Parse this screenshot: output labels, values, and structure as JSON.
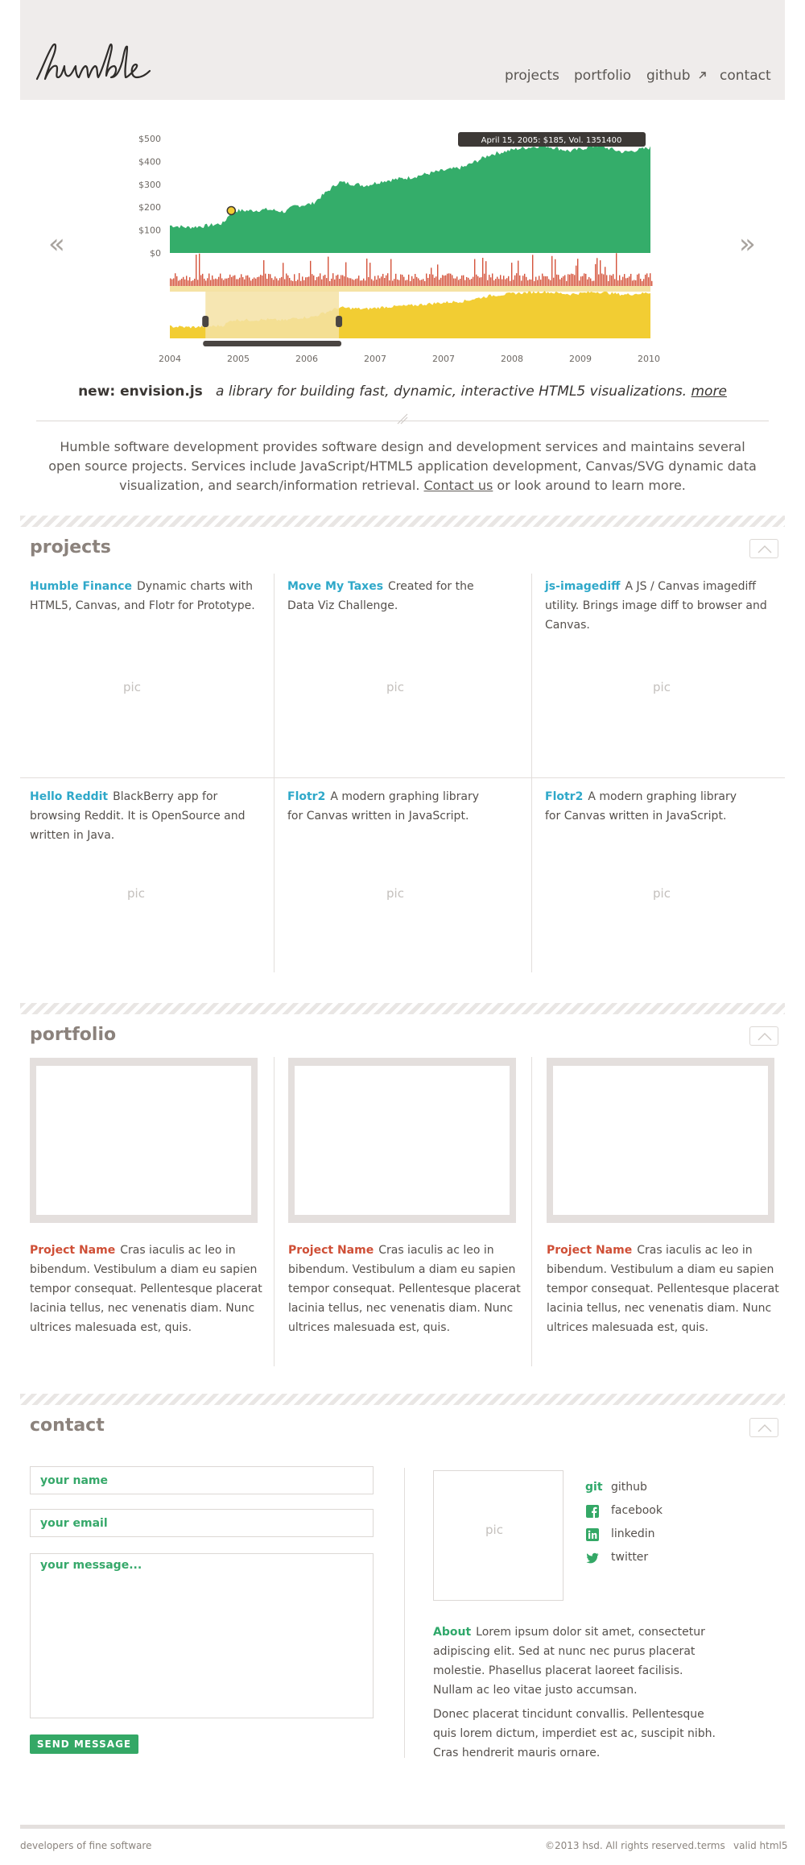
{
  "header": {
    "logo_text": "humble",
    "nav": [
      {
        "label": "projects"
      },
      {
        "label": "portfolio"
      },
      {
        "label": "github"
      },
      {
        "label": "contact"
      }
    ]
  },
  "chart_data": {
    "type": "area",
    "tooltip": "April 15, 2005: $185, Vol. 1351400",
    "y_ticks": [
      "$500",
      "$400",
      "$300",
      "$200",
      "$100",
      "$0"
    ],
    "ylim": [
      0,
      500
    ],
    "x_ticks": [
      "2004",
      "2005",
      "2006",
      "2007",
      "2007",
      "2008",
      "2009",
      "2010"
    ],
    "xlim": [
      2004.6,
      2010
    ],
    "colors": {
      "price": "#34ad6a",
      "volume": "#d4533b",
      "summary": "#f2cd33",
      "selection": "#f5e2a4"
    },
    "selection": [
      2005.0,
      2006.5
    ],
    "highlight_point": {
      "x": 2005.29,
      "y": 185
    },
    "series": [
      {
        "values": [
          [
            2004.6,
            120
          ],
          [
            2004.8,
            112
          ],
          [
            2005.0,
            118
          ],
          [
            2005.2,
            130
          ],
          [
            2005.3,
            185
          ],
          [
            2005.5,
            185
          ],
          [
            2005.7,
            190
          ],
          [
            2005.9,
            180
          ],
          [
            2006.0,
            205
          ],
          [
            2006.2,
            215
          ],
          [
            2006.5,
            310
          ],
          [
            2006.8,
            295
          ],
          [
            2007.0,
            315
          ],
          [
            2007.3,
            330
          ],
          [
            2007.6,
            355
          ],
          [
            2007.9,
            375
          ],
          [
            2008.2,
            430
          ],
          [
            2008.5,
            455
          ],
          [
            2008.8,
            470
          ],
          [
            2009.1,
            445
          ],
          [
            2009.4,
            470
          ],
          [
            2009.7,
            440
          ],
          [
            2010,
            460
          ]
        ]
      }
    ]
  },
  "tagline": {
    "name": "new: envision.js",
    "desc": "a library for building fast, dynamic, interactive HTML5 visualizations.",
    "more": "more"
  },
  "intro": {
    "text_1": "Humble software development provides software design and development services and maintains several open source projects. Services include JavaScript/HTML5 application development, Canvas/SVG dynamic data visualization, and search/information retrieval.",
    "link": "Contact us",
    "text_2": "or look around to learn more."
  },
  "projects": {
    "title": "projects",
    "items": [
      {
        "title": "Humble Finance",
        "desc": "Dynamic charts with HTML5, Canvas, and Flotr for Prototype.",
        "pic": "pic"
      },
      {
        "title": "Move My Taxes",
        "desc": "Created for the Data Viz Challenge.",
        "pic": "pic"
      },
      {
        "title": "js-imagediff",
        "desc": "A JS / Canvas imagediff utility. Brings image diff to browser and Canvas.",
        "pic": "pic"
      },
      {
        "title": "Hello Reddit",
        "desc": "BlackBerry app for browsing Reddit. It is OpenSource and written in Java.",
        "pic": "pic"
      },
      {
        "title": "Flotr2",
        "desc": "A modern graphing library for Canvas written in JavaScript.",
        "pic": "pic"
      },
      {
        "title": "Flotr2",
        "desc": "A modern graphing library for Canvas written in JavaScript.",
        "pic": "pic"
      }
    ]
  },
  "portfolio": {
    "title": "portfolio",
    "items": [
      {
        "name": "Project Name",
        "desc": "Cras iaculis ac leo in bibendum. Vestibulum a diam eu sapien tempor consequat. Pellentesque placerat lacinia tellus, nec venenatis diam. Nunc ultrices malesuada est, quis."
      },
      {
        "name": "Project Name",
        "desc": "Cras iaculis ac leo in bibendum. Vestibulum a diam eu sapien tempor consequat. Pellentesque placerat lacinia tellus, nec venenatis diam. Nunc ultrices malesuada est, quis."
      },
      {
        "name": "Project Name",
        "desc": "Cras iaculis ac leo in bibendum. Vestibulum a diam eu sapien tempor consequat. Pellentesque placerat lacinia tellus, nec venenatis diam. Nunc ultrices malesuada est, quis."
      }
    ]
  },
  "contact": {
    "title": "contact",
    "name_placeholder": "your name",
    "email_placeholder": "your email",
    "message_placeholder": "your message...",
    "send_label": "SEND MESSAGE",
    "avatar_pic": "pic",
    "social": [
      {
        "icon": "git-icon",
        "label": "github"
      },
      {
        "icon": "facebook-icon",
        "label": "facebook"
      },
      {
        "icon": "linkedin-icon",
        "label": "linkedin"
      },
      {
        "icon": "twitter-icon",
        "label": "twitter"
      }
    ],
    "git_icon_text": "git",
    "about_label": "About",
    "about_p1": "Lorem ipsum dolor sit amet, consectetur adipiscing elit. Sed at nunc nec purus placerat molestie. Phasellus placerat laoreet facilisis. Nullam ac leo vitae justo accumsan.",
    "about_p2": "Donec placerat tincidunt convallis. Pellentesque quis lorem dictum, imperdiet est ac, suscipit nibh. Cras hendrerit mauris ornare."
  },
  "footer": {
    "left": "developers of fine software",
    "copyright": "©2013 hsd. All rights reserved.",
    "terms": "terms",
    "valid": "valid html5"
  },
  "colors": {
    "accent_blue": "#2fa8c9",
    "accent_green": "#34a866",
    "accent_red": "#cf4f36",
    "header_bg": "#efeceb"
  }
}
